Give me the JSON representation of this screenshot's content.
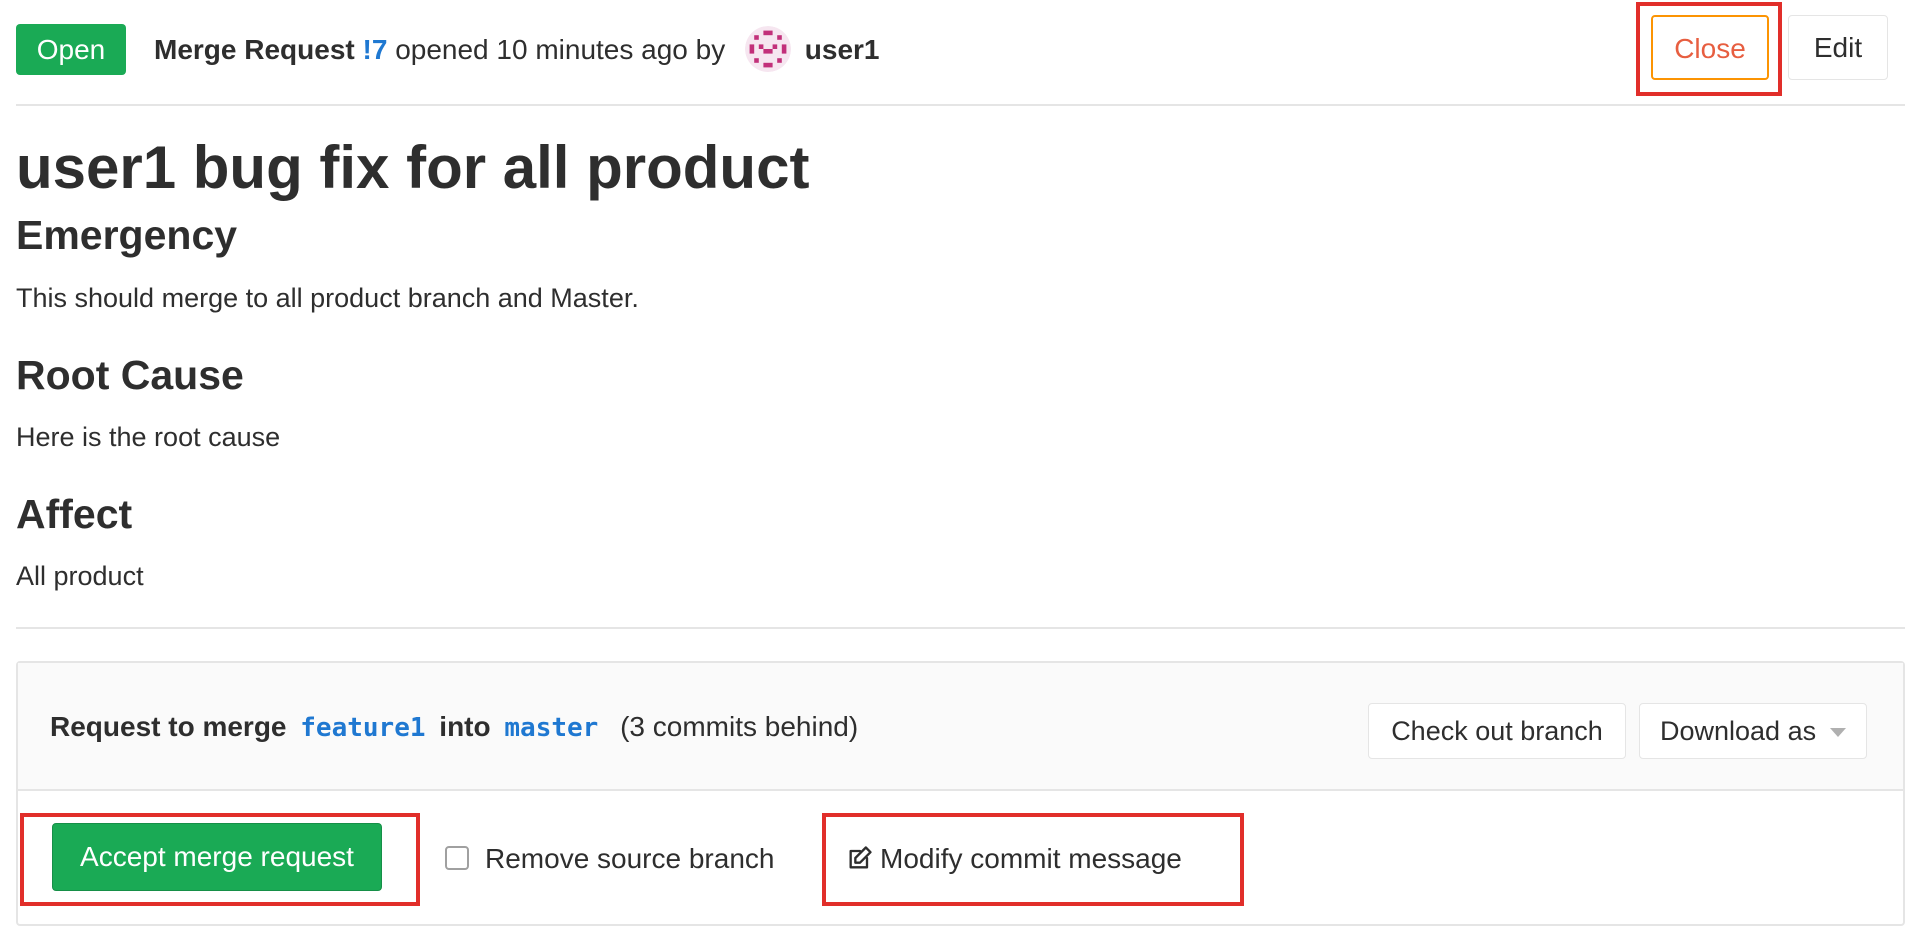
{
  "header": {
    "status_badge": "Open",
    "mr_label": "Merge Request",
    "mr_ref": "!7",
    "opened_text": "opened 10 minutes ago by",
    "author": "user1",
    "close_label": "Close",
    "edit_label": "Edit"
  },
  "description": {
    "title": "user1 bug fix for all product",
    "sections": [
      {
        "heading": "Emergency",
        "text": "This should merge to all product branch and Master."
      },
      {
        "heading": "Root Cause",
        "text": "Here is the root cause"
      },
      {
        "heading": "Affect",
        "text": "All product"
      }
    ]
  },
  "merge_widget": {
    "request_prefix": "Request to merge",
    "source_branch": "feature1",
    "into_text": "into",
    "target_branch": "master",
    "behind_text": "(3 commits behind)",
    "checkout_label": "Check out branch",
    "download_label": "Download as",
    "accept_label": "Accept merge request",
    "remove_source_label": "Remove source branch",
    "remove_source_checked": false,
    "modify_commit_label": "Modify commit message"
  },
  "icons": {
    "avatar": "identicon-avatar",
    "modify_commit": "edit-icon",
    "download_caret": "caret-down-icon"
  },
  "colors": {
    "open_badge": "#1aaa55",
    "link": "#1f78d1",
    "close_border": "#fc9403",
    "close_text": "#e75e40",
    "accept_button": "#1aaa55",
    "highlight_box": "#e12e2a"
  }
}
